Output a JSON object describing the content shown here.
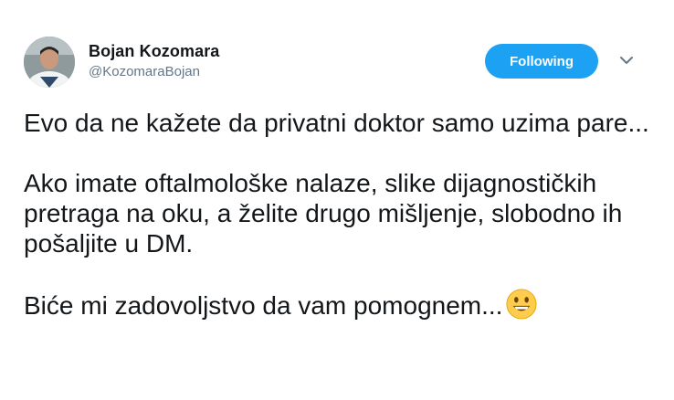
{
  "user": {
    "display_name": "Bojan Kozomara",
    "handle": "@KozomaraBojan"
  },
  "actions": {
    "follow_label": "Following",
    "caret_icon": "chevron-down-icon"
  },
  "tweet": {
    "p1": "Evo da ne kažete da privatni doktor samo uzima pare...",
    "p2": "Ako imate oftalmološke nalaze, slike dijagnostičkih pretraga na oku, a želite drugo mišljenje, slobodno ih pošaljite u DM.",
    "p3": "Biće mi zadovoljstvo da vam pomognem...",
    "p3_emoji": "smiling-face-emoji"
  },
  "colors": {
    "accent": "#1da1f2",
    "text": "#14171a",
    "muted": "#657786"
  }
}
